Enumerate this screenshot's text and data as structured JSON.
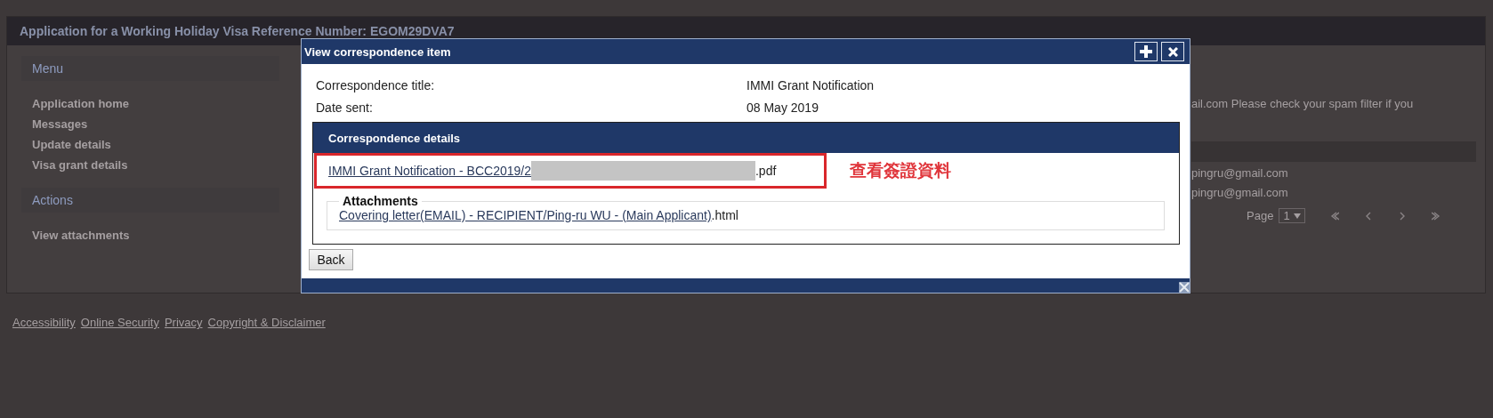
{
  "background_page": {
    "header_title": "Application for a Working Holiday Visa Reference Number: EGOM29DVA7",
    "sidebar": [
      {
        "heading": "Menu",
        "items": [
          "Application home",
          "Messages",
          "Update details",
          "Visa grant details"
        ]
      },
      {
        "heading": "Actions",
        "items": [
          "View attachments"
        ]
      }
    ],
    "notice": "ail.com Please check your spam filter if you",
    "recipients": [
      "pingru@gmail.com",
      "pingru@gmail.com"
    ],
    "pager": {
      "label": "Page",
      "value": "1"
    },
    "footer_links": [
      "Accessibility",
      "Online Security",
      "Privacy",
      "Copyright & Disclaimer"
    ]
  },
  "dialog": {
    "title": "View correspondence item",
    "fields": [
      {
        "label": "Correspondence title:",
        "value": "IMMI Grant Notification"
      },
      {
        "label": "Date sent:",
        "value": "08 May 2019"
      }
    ],
    "details": {
      "heading": "Correspondence details",
      "document": {
        "link": "IMMI Grant Notification - BCC2019/2",
        "suffix": ".pdf",
        "highlighted": true
      },
      "attachments": {
        "legend": "Attachments",
        "items": [
          {
            "link": "Covering letter(EMAIL) - RECIPIENT/Ping-ru WU - (Main Applicant)",
            "suffix": ".html"
          }
        ]
      }
    },
    "back_button": "Back"
  },
  "annotation": {
    "text": "查看簽證資料"
  }
}
